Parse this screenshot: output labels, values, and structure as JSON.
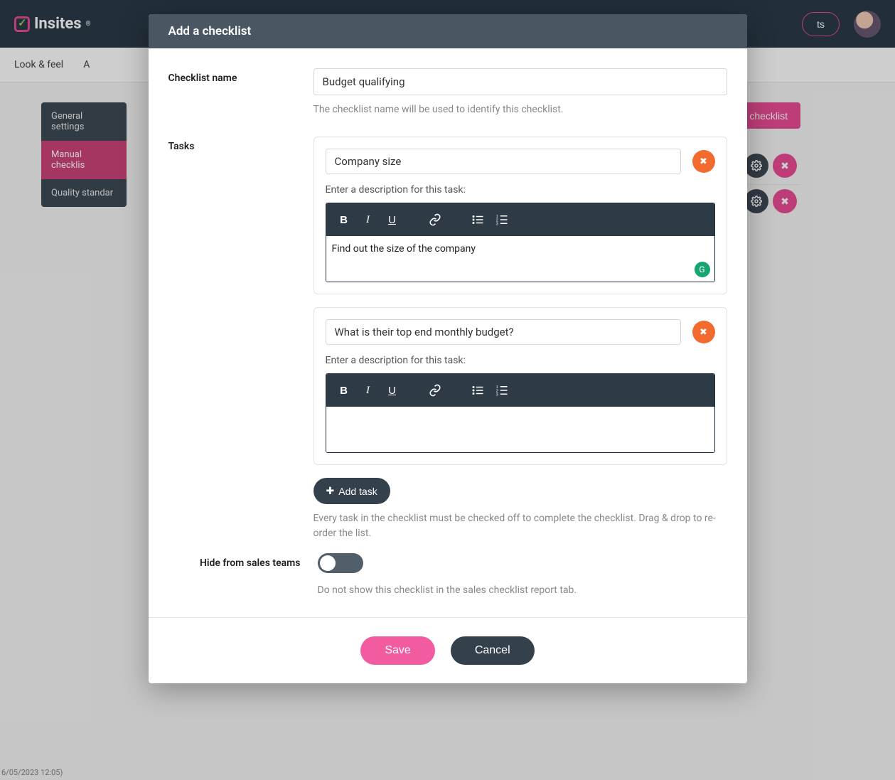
{
  "topbar": {
    "brand": "Insites",
    "reg": "®",
    "pill_fragment": "ts"
  },
  "subnav": {
    "item0": "Look & feel",
    "item1_prefix": "A"
  },
  "sidebar": {
    "items": [
      {
        "label": "General settings"
      },
      {
        "label": "Manual checklis"
      },
      {
        "label": "Quality standar"
      }
    ]
  },
  "page": {
    "add_checklist_label": "Add checklist"
  },
  "modal": {
    "title": "Add a checklist",
    "labels": {
      "checklist_name": "Checklist name",
      "tasks": "Tasks",
      "hide_from_sales": "Hide from sales teams"
    },
    "checklist_name_value": "Budget qualifying",
    "checklist_name_help": "The checklist name will be used to identify this checklist.",
    "tasks": [
      {
        "title": "Company size",
        "desc_label": "Enter a description for this task:",
        "content": "Find out the size of the company",
        "show_grammarly": true
      },
      {
        "title": "What is their top end monthly budget?",
        "desc_label": "Enter a description for this task:",
        "content": "",
        "show_grammarly": false
      }
    ],
    "add_task_label": "Add task",
    "tasks_help": "Every task in the checklist must be checked off to complete the checklist. Drag & drop to re-order the list.",
    "hide_help": "Do not show this checklist in the sales checklist report tab.",
    "save_label": "Save",
    "cancel_label": "Cancel"
  },
  "footer_timestamp": "6/05/2023 12:05)"
}
